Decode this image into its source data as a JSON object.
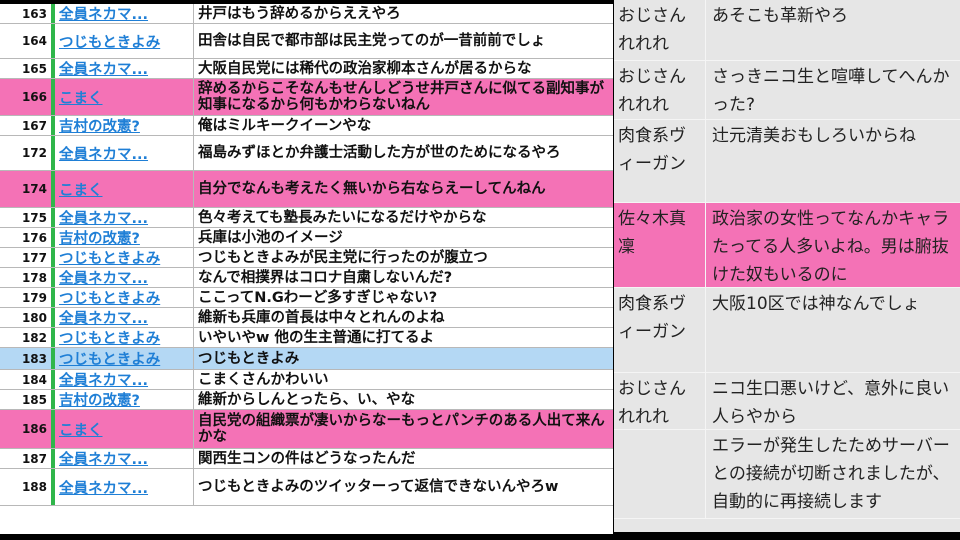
{
  "comments": [
    {
      "num": "163",
      "name": "全員ネカマ...",
      "text": "井戸はもう辞めるからええやろ",
      "style": "normal",
      "h": 19
    },
    {
      "num": "164",
      "name": "つじもときよみ",
      "text": "田舎は自民で都市部は民主党ってのが一昔前前でしょ",
      "style": "normal",
      "h": 34
    },
    {
      "num": "165",
      "name": "全員ネカマ...",
      "text": "大阪自民党には稀代の政治家柳本さんが居るからな",
      "style": "normal",
      "h": 19
    },
    {
      "num": "166",
      "name": "こまく",
      "text": "辞めるからこそなんもせんしどうせ井戸さんに似てる副知事が知事になるから何もかわらないねん",
      "style": "pink",
      "h": 36
    },
    {
      "num": "167",
      "name": "吉村の改憲?",
      "text": "俺はミルキークイーンやな",
      "style": "normal",
      "h": 19
    },
    {
      "num": "172",
      "name": "全員ネカマ...",
      "text": "福島みずほとか弁護士活動した方が世のためになるやろ",
      "style": "normal",
      "h": 34
    },
    {
      "num": "174",
      "name": "こまく",
      "text": "自分でなんも考えたく無いから右ならえーしてんねん",
      "style": "pink",
      "h": 36
    },
    {
      "num": "175",
      "name": "全員ネカマ...",
      "text": "色々考えても塾長みたいになるだけやからな",
      "style": "normal",
      "h": 19
    },
    {
      "num": "176",
      "name": "吉村の改憲?",
      "text": "兵庫は小池のイメージ",
      "style": "normal",
      "h": 19
    },
    {
      "num": "177",
      "name": "つじもときよみ",
      "text": "つじもときよみが民主党に行ったのが腹立つ",
      "style": "normal",
      "h": 19
    },
    {
      "num": "178",
      "name": "全員ネカマ...",
      "text": "なんで相撲界はコロナ自粛しないんだ?",
      "style": "normal",
      "h": 19
    },
    {
      "num": "179",
      "name": "つじもときよみ",
      "text": "ここってN.Gわーど多すぎじゃない?",
      "style": "normal",
      "h": 19
    },
    {
      "num": "180",
      "name": "全員ネカマ...",
      "text": "維新も兵庫の首長は中々とれんのよね",
      "style": "normal",
      "h": 19
    },
    {
      "num": "182",
      "name": "つじもときよみ",
      "text": "いやいやw 他の生主普通に打てるよ",
      "style": "normal",
      "h": 19
    },
    {
      "num": "183",
      "name": "つじもときよみ",
      "text": "つじもときよみ",
      "style": "sel",
      "h": 21
    },
    {
      "num": "184",
      "name": "全員ネカマ...",
      "text": "こまくさんかわいい",
      "style": "normal",
      "h": 19
    },
    {
      "num": "185",
      "name": "吉村の改憲?",
      "text": "維新からしんとったら、い、やな",
      "style": "normal",
      "h": 19
    },
    {
      "num": "186",
      "name": "こまく",
      "text": "自民党の組織票が凄いからなーもっとパンチのある人出て来んかな",
      "style": "pink",
      "h": 38
    },
    {
      "num": "187",
      "name": "全員ネカマ...",
      "text": "関西生コンの件はどうなったんだ",
      "style": "normal",
      "h": 19
    },
    {
      "num": "188",
      "name": "全員ネカマ...",
      "text": "つじもときよみのツイッターって返信できないんやろw",
      "style": "normal",
      "h": 36
    }
  ],
  "chat": [
    {
      "user": "おじさんれれれ",
      "msg": "あそこも革新やろ",
      "style": "normal",
      "h": 60
    },
    {
      "user": "おじさんれれれ",
      "msg": "さっきニコ生と喧嘩してへんかった?",
      "style": "normal",
      "h": 58
    },
    {
      "user": "肉食系ヴィーガン",
      "msg": "辻元清美おもしろいからね",
      "style": "normal",
      "h": 82
    },
    {
      "user": "佐々木真凜",
      "msg": "政治家の女性ってなんかキャラたってる人多いよね。男は腑抜けた奴もいるのに",
      "style": "pink",
      "h": 84
    },
    {
      "user": "肉食系ヴィーガン",
      "msg": "大阪10区では神なんでしょ",
      "style": "normal",
      "h": 84
    },
    {
      "user": "おじさんれれれ",
      "msg": "ニコ生口悪いけど、意外に良い人らやから",
      "style": "normal",
      "h": 56
    },
    {
      "user": "",
      "msg": "エラーが発生したためサーバーとの接続が切断されましたが、自動的に再接続します",
      "style": "normal",
      "h": 88
    }
  ]
}
